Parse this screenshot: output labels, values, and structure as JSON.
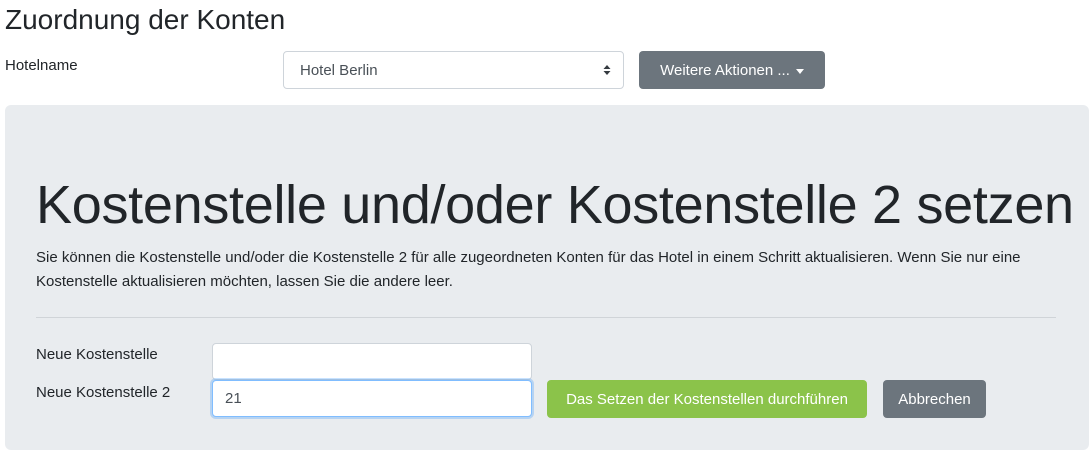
{
  "page": {
    "title": "Zuordnung der Konten"
  },
  "header": {
    "hotel_label": "Hotelname",
    "hotel_select": {
      "selected": "Hotel Berlin",
      "icon": "select-updown-caret-icon"
    },
    "actions_button": {
      "label": "Weitere Aktionen ...",
      "icon": "caret-down-icon"
    }
  },
  "panel": {
    "heading": "Kostenstelle und/oder Kostenstelle 2 setzen",
    "description": "Sie können die Kostenstelle und/oder die Kostenstelle 2 für alle zugeordneten Konten für das Hotel in einem Schritt aktualisieren. Wenn Sie nur eine Kostenstelle aktualisieren möchten, lassen Sie die andere leer.",
    "fields": [
      {
        "label": "Neue Kostenstelle",
        "value": ""
      },
      {
        "label": "Neue Kostenstelle 2",
        "value": "21"
      }
    ],
    "submit_label": "Das Setzen der Kostenstellen durchführen",
    "cancel_label": "Abbrechen"
  },
  "colors": {
    "panel_background": "#e9ecef",
    "secondary_button": "#6c757d",
    "success_button": "#8bc34a",
    "focus_border": "#80bdff"
  }
}
